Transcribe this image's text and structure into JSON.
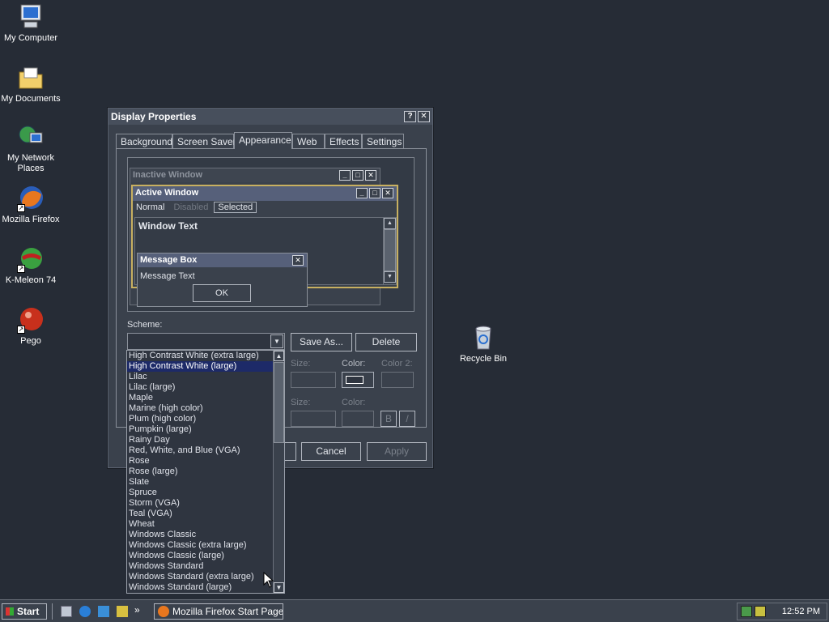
{
  "desktop": {
    "icons": [
      {
        "label": "My Computer"
      },
      {
        "label": "My Documents"
      },
      {
        "label": "My Network Places"
      },
      {
        "label": "Mozilla Firefox"
      },
      {
        "label": "K-Meleon 74"
      },
      {
        "label": "Pego"
      },
      {
        "label": "Recycle Bin"
      }
    ]
  },
  "dialog": {
    "title": "Display Properties",
    "help_glyph": "?",
    "close_glyph": "✕",
    "tabs": [
      {
        "label": "Background"
      },
      {
        "label": "Screen Saver"
      },
      {
        "label": "Appearance"
      },
      {
        "label": "Web"
      },
      {
        "label": "Effects"
      },
      {
        "label": "Settings"
      }
    ],
    "active_tab": "Appearance",
    "preview": {
      "inactive_title": "Inactive Window",
      "active_title": "Active Window",
      "menu": {
        "normal": "Normal",
        "disabled": "Disabled",
        "selected": "Selected"
      },
      "window_text": "Window Text",
      "msgbox_title": "Message Box",
      "msgbox_text": "Message Text",
      "ok": "OK"
    },
    "scheme_label": "Scheme:",
    "save_as": "Save As...",
    "delete": "Delete",
    "size_label": "Size:",
    "color_label": "Color:",
    "color2_label": "Color 2:",
    "bold_glyph": "B",
    "italic_glyph": "/",
    "cancel": "Cancel",
    "apply": "Apply"
  },
  "scheme_list": {
    "selected": "High Contrast White (large)",
    "items": [
      "High Contrast White (extra large)",
      "High Contrast White (large)",
      "Lilac",
      "Lilac (large)",
      "Maple",
      "Marine (high color)",
      "Plum (high color)",
      "Pumpkin (large)",
      "Rainy Day",
      "Red, White, and Blue (VGA)",
      "Rose",
      "Rose (large)",
      "Slate",
      "Spruce",
      "Storm (VGA)",
      "Teal (VGA)",
      "Wheat",
      "Windows Classic",
      "Windows Classic (extra large)",
      "Windows Classic (large)",
      "Windows Standard",
      "Windows Standard (extra large)",
      "Windows Standard (large)"
    ]
  },
  "taskbar": {
    "start": "Start",
    "chevron": "»",
    "task_label": "Mozilla Firefox Start Page...",
    "clock": "12:52 PM"
  },
  "colors": {
    "desktop": "#262c36",
    "selection": "#1d2a68",
    "active_title": "#474f5c"
  }
}
